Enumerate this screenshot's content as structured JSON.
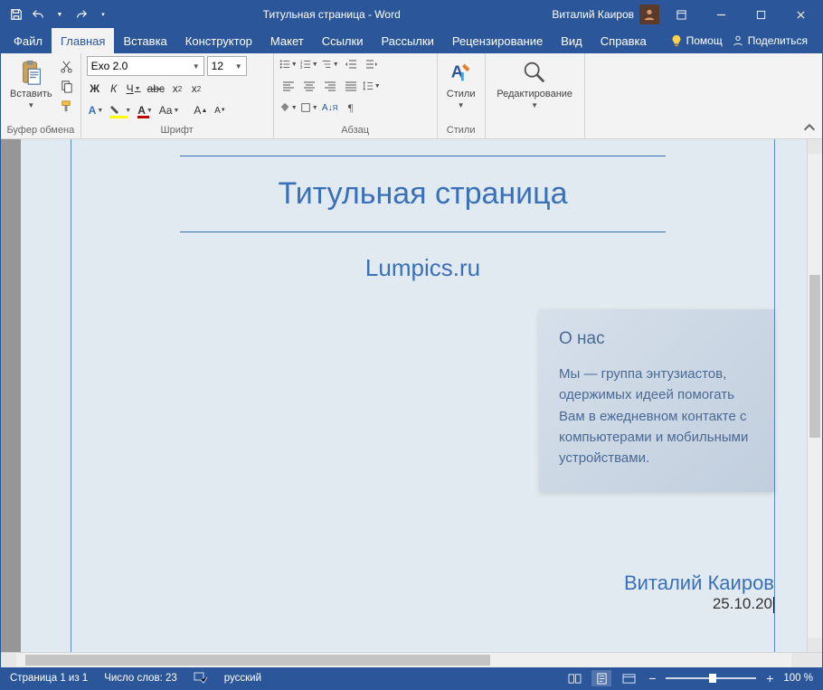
{
  "titlebar": {
    "doc_title": "Титульная страница  -  Word",
    "user": "Виталий Каиров"
  },
  "tabs": {
    "file": "Файл",
    "home": "Главная",
    "insert": "Вставка",
    "design": "Конструктор",
    "layout": "Макет",
    "references": "Ссылки",
    "mailings": "Рассылки",
    "review": "Рецензирование",
    "view": "Вид",
    "help_tab": "Справка",
    "tell_me": "Помощ",
    "share": "Поделиться"
  },
  "ribbon": {
    "clipboard": {
      "label": "Буфер обмена",
      "paste": "Вставить"
    },
    "font": {
      "label": "Шрифт",
      "name": "Exo 2.0",
      "size": "12",
      "bold": "Ж",
      "italic": "К",
      "underline": "Ч",
      "strike": "abc",
      "caseAa": "Aa"
    },
    "paragraph": {
      "label": "Абзац"
    },
    "styles": {
      "label": "Стили",
      "button": "Стили"
    },
    "editing": {
      "label": "Редактирование"
    }
  },
  "document": {
    "title": "Титульная страница",
    "subtitle": "Lumpics.ru",
    "about_title": "О нас",
    "about_body": "Мы — группа энтузиастов, одержимых идеей помогать Вам в ежедневном контакте с компьютерами и мобильными устройствами.",
    "author": "Виталий Каиров",
    "date": "25.10.20"
  },
  "status": {
    "page": "Страница 1 из 1",
    "words": "Число слов: 23",
    "lang": "русский",
    "zoom": "100 %"
  },
  "colors": {
    "accent": "#2b579a",
    "doc_accent": "#3a70b8"
  }
}
